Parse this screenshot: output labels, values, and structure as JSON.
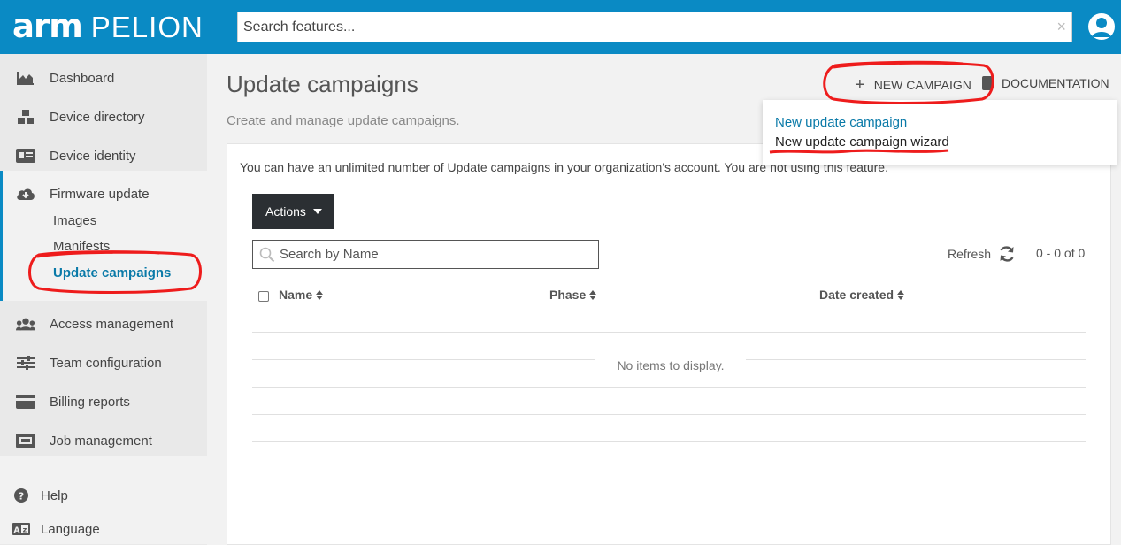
{
  "header": {
    "brand_arm": "arm",
    "brand_pelion": "PELION",
    "search_placeholder": "Search features...",
    "clear_symbol": "×",
    "accent_color": "#0a8ac4"
  },
  "sidebar": {
    "items": [
      {
        "label": "Dashboard",
        "icon": "area-chart-icon"
      },
      {
        "label": "Device directory",
        "icon": "cubes-icon"
      },
      {
        "label": "Device identity",
        "icon": "id-card-icon"
      },
      {
        "label": "Firmware update",
        "icon": "cloud-download-icon"
      },
      {
        "label": "Access management",
        "icon": "users-icon"
      },
      {
        "label": "Team configuration",
        "icon": "sliders-icon"
      },
      {
        "label": "Billing reports",
        "icon": "credit-card-icon"
      },
      {
        "label": "Job management",
        "icon": "ticket-icon"
      }
    ],
    "firmware_sub": {
      "images": "Images",
      "manifests": "Manifests",
      "update_campaigns": "Update campaigns"
    },
    "bottom": {
      "help": "Help",
      "language": "Language"
    }
  },
  "main": {
    "title": "Update campaigns",
    "subtitle": "Create and manage update campaigns.",
    "new_campaign_label": "NEW CAMPAIGN",
    "documentation_label": "DOCUMENTATION",
    "dropdown": {
      "option1": "New update campaign",
      "option2": "New update campaign wizard"
    },
    "info_text": "You can have an unlimited number of Update campaigns in your organization's account. You are not using this feature.",
    "actions_label": "Actions",
    "name_search_placeholder": "Search by Name",
    "refresh_label": "Refresh",
    "pager_text": "0 - 0 of 0",
    "columns": [
      "Name",
      "Phase",
      "Date created"
    ],
    "empty_text": "No items to display."
  }
}
